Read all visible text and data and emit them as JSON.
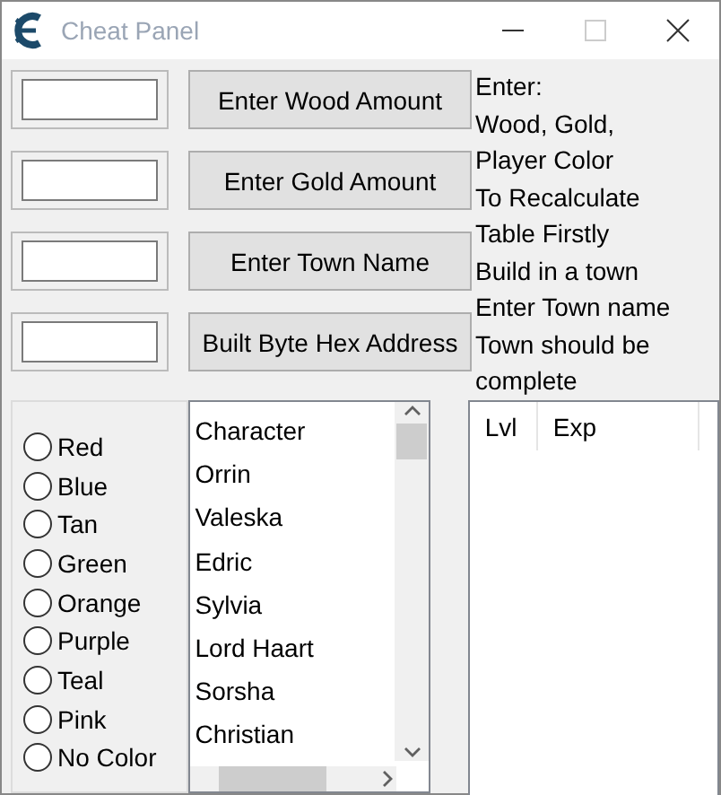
{
  "window": {
    "title": "Cheat Panel"
  },
  "rows": [
    {
      "value": "",
      "button": "Enter Wood Amount"
    },
    {
      "value": "",
      "button": "Enter Gold Amount"
    },
    {
      "value": "",
      "button": "Enter Town Name"
    },
    {
      "value": "",
      "button": "Built Byte Hex Address"
    }
  ],
  "instructions": [
    "Enter:",
    "Wood, Gold,",
    "Player Color",
    "To Recalculate",
    "Table Firstly",
    "Build in a town",
    "Enter Town name",
    "Town should be",
    "complete"
  ],
  "colors": [
    {
      "label": "Red",
      "selected": false
    },
    {
      "label": "Blue",
      "selected": false
    },
    {
      "label": "Tan",
      "selected": false
    },
    {
      "label": "Green",
      "selected": false
    },
    {
      "label": "Orange",
      "selected": false
    },
    {
      "label": "Purple",
      "selected": false
    },
    {
      "label": "Teal",
      "selected": false
    },
    {
      "label": "Pink",
      "selected": false
    },
    {
      "label": "No Color",
      "selected": false
    }
  ],
  "characters": {
    "items": [
      "Character",
      "Orrin",
      "Valeska",
      "Edric",
      "Sylvia",
      "Lord Haart",
      "Sorsha",
      "Christian"
    ]
  },
  "table": {
    "columns": [
      "Lvl",
      "Exp"
    ]
  }
}
